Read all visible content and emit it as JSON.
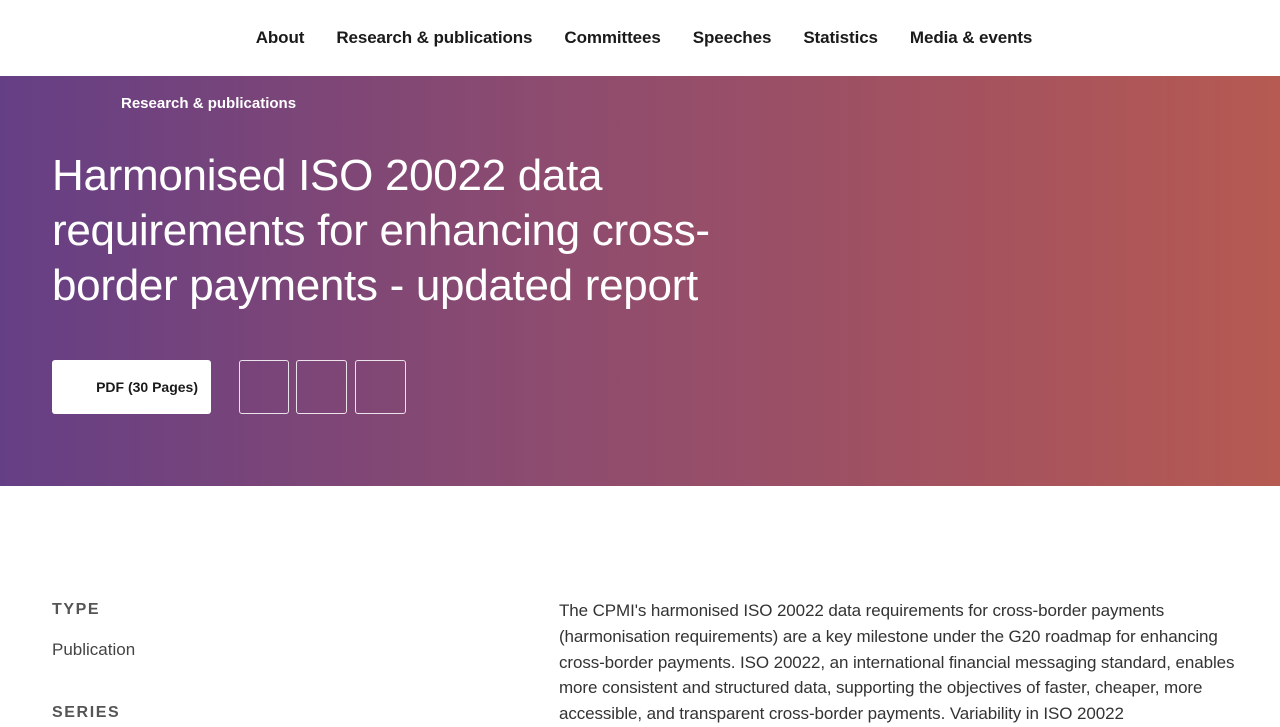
{
  "nav": {
    "items": [
      "About",
      "Research & publications",
      "Committees",
      "Speeches",
      "Statistics",
      "Media & events"
    ]
  },
  "hero": {
    "breadcrumb": "Research & publications",
    "title": "Harmonised ISO 20022 data requirements for enhancing cross-border payments - updated report",
    "pdf_label": "PDF (30 Pages)",
    "gradient_colors": [
      "#653f85",
      "#b65a52"
    ]
  },
  "meta": {
    "type_label": "TYPE",
    "type_value": "Publication",
    "series_label": "SERIES"
  },
  "body": {
    "paragraph": "The CPMI's harmonised ISO 20022 data requirements for cross-border payments (harmonisation requirements) are a key milestone under the G20 roadmap for enhancing cross-border payments. ISO 20022, an international financial messaging standard, enables more consistent and structured data, supporting the objectives of faster, cheaper, more accessible, and transparent cross-border payments. Variability in ISO 20022"
  }
}
